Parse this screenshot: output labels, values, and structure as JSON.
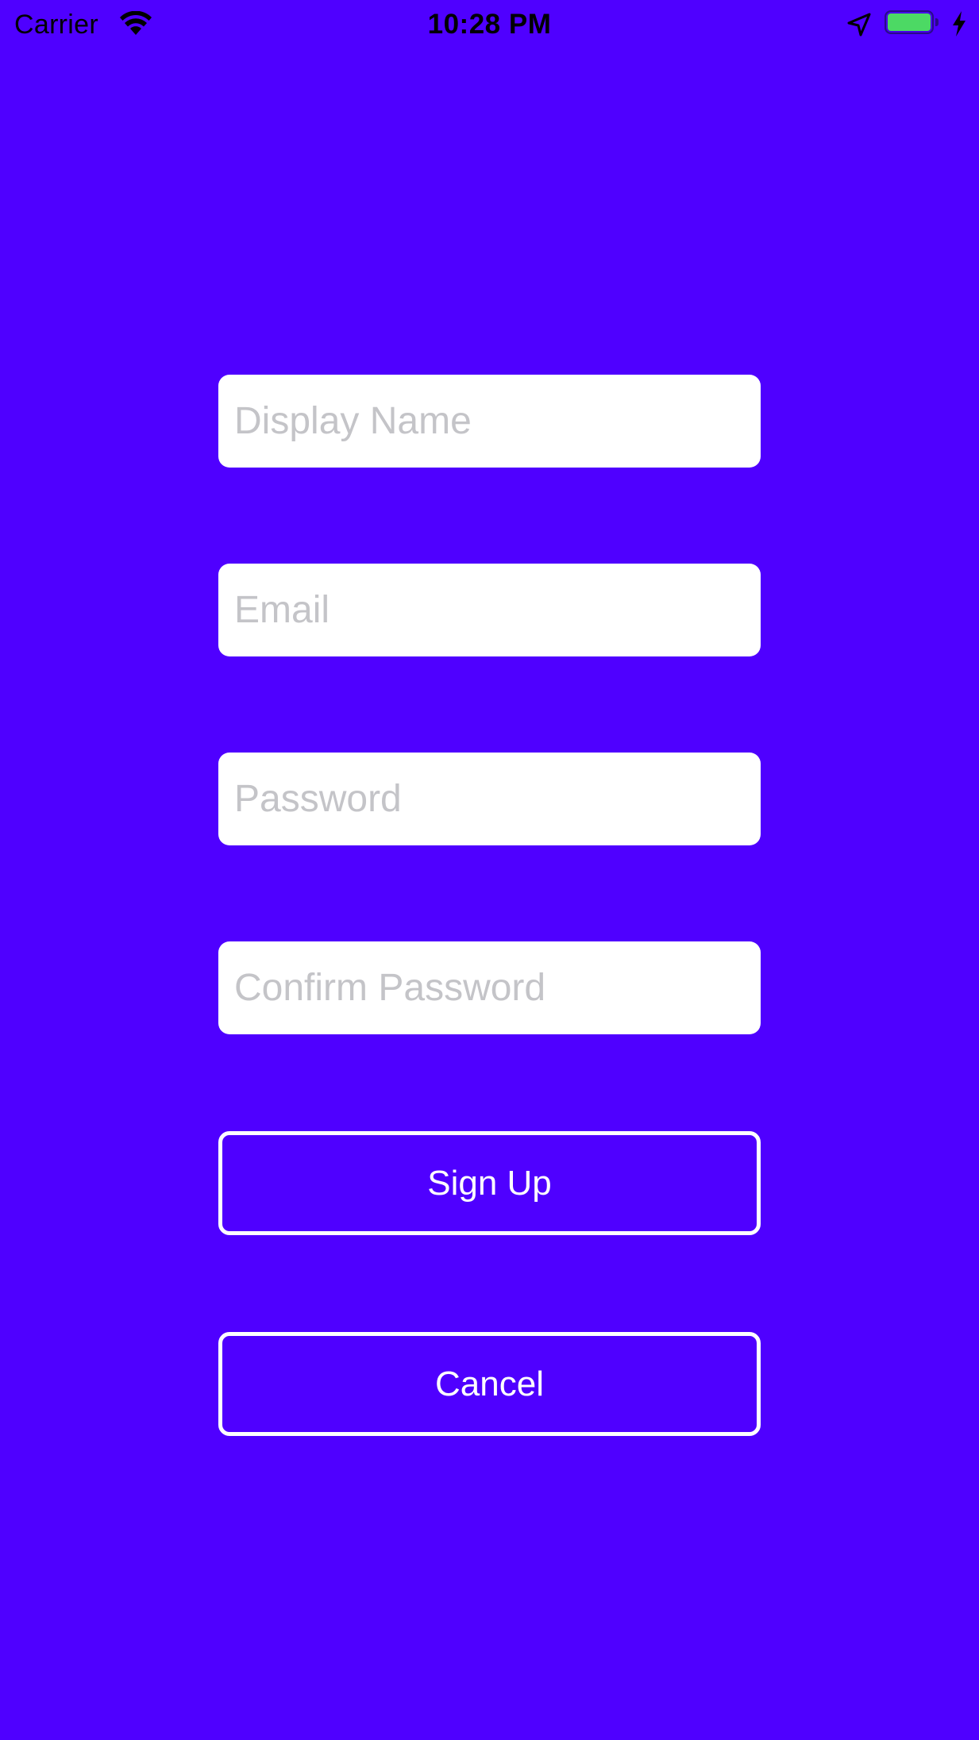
{
  "status_bar": {
    "carrier": "Carrier",
    "time": "10:28 PM",
    "icons": [
      "wifi-icon",
      "location-icon",
      "battery-icon",
      "charging-icon"
    ],
    "battery_color": "#4CD964"
  },
  "form": {
    "display_name": {
      "placeholder": "Display Name",
      "value": ""
    },
    "email": {
      "placeholder": "Email",
      "value": ""
    },
    "password": {
      "placeholder": "Password",
      "value": ""
    },
    "confirm_password": {
      "placeholder": "Confirm Password",
      "value": ""
    },
    "signup_label": "Sign Up",
    "cancel_label": "Cancel"
  },
  "colors": {
    "background": "#4F00FF",
    "field_background": "#FFFFFF",
    "placeholder": "#C4C4C8",
    "button_border": "#FFFFFF"
  }
}
